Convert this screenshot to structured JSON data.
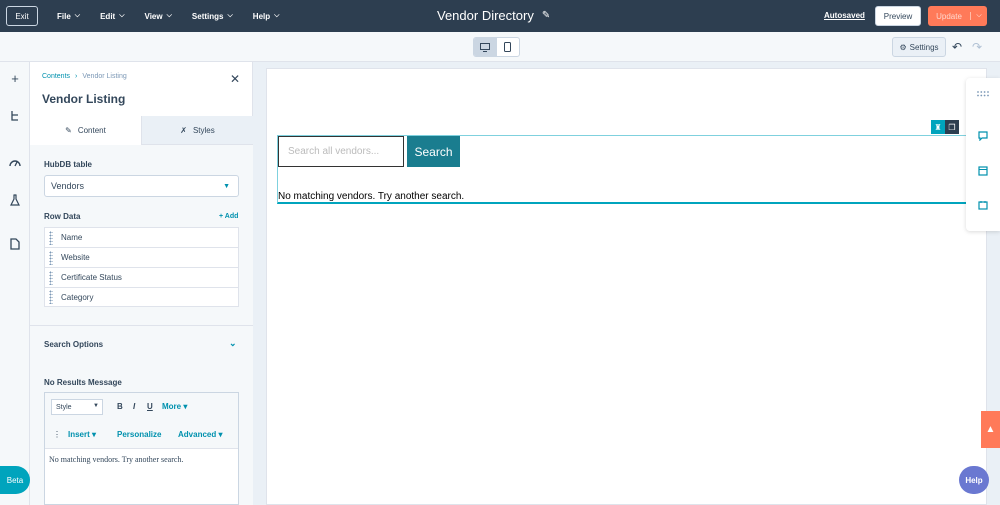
{
  "topbar": {
    "exit_label": "Exit",
    "menu": [
      {
        "label": "File"
      },
      {
        "label": "Edit"
      },
      {
        "label": "View"
      },
      {
        "label": "Settings"
      },
      {
        "label": "Help"
      }
    ],
    "title": "Vendor Directory",
    "autosaved": "Autosaved",
    "preview_label": "Preview",
    "update_label": "Update"
  },
  "toolbar": {
    "settings_label": "Settings"
  },
  "panel": {
    "breadcrumb": [
      "Contents",
      "Vendor Listing"
    ],
    "title": "Vendor Listing",
    "tabs": [
      {
        "label": "Content",
        "icon": "pencil-icon"
      },
      {
        "label": "Styles",
        "icon": "styles-icon"
      }
    ],
    "hubdb_label": "HubDB table",
    "hubdb_value": "Vendors",
    "row_data_label": "Row Data",
    "add_label": "+ Add",
    "rows": [
      "Name",
      "Website",
      "Certificate Status",
      "Category"
    ],
    "search_options_label": "Search Options",
    "no_results_label": "No Results Message",
    "rte": {
      "style_label": "Style",
      "bold": "B",
      "italic": "I",
      "underline": "U",
      "more": "More",
      "insert": "Insert",
      "personalize": "Personalize",
      "advanced": "Advanced",
      "content": "No matching vendors. Try another search."
    }
  },
  "canvas": {
    "search_placeholder": "Search all vendors...",
    "search_button": "Search",
    "no_results": "No matching vendors. Try another search."
  },
  "badges": {
    "beta": "Beta",
    "help": "Help"
  },
  "colors": {
    "topbar": "#2d3e50",
    "accent": "#0091ae",
    "update": "#ff7a59",
    "search_button": "#1a7d8f"
  }
}
